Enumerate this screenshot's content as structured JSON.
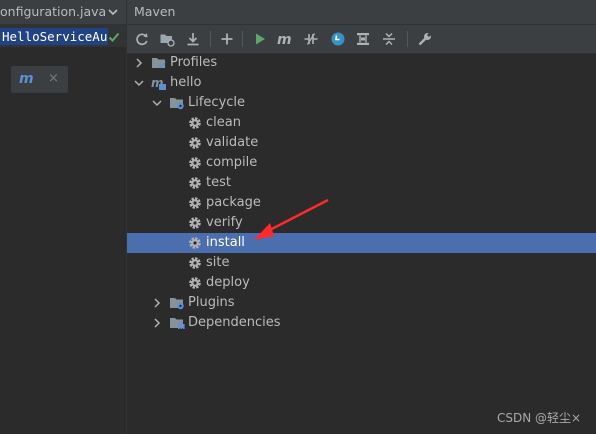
{
  "editor": {
    "tab_title": "onfiguration.java",
    "code_text": "HelloServiceAu"
  },
  "left_panel": {
    "file_close_glyph": "×"
  },
  "maven": {
    "title": "Maven",
    "toolbar": [
      {
        "name": "reload-icon"
      },
      {
        "name": "generate-sources-icon"
      },
      {
        "name": "download-icon"
      },
      {
        "name": "add-icon"
      },
      {
        "name": "run-icon"
      },
      {
        "name": "execute-goal-icon"
      },
      {
        "name": "toggle-offline-icon"
      },
      {
        "name": "skip-tests-icon"
      },
      {
        "name": "show-dependencies-icon"
      },
      {
        "name": "collapse-all-icon"
      },
      {
        "name": "settings-wrench-icon"
      }
    ],
    "tree": {
      "profiles": "Profiles",
      "project": "hello",
      "lifecycle": "Lifecycle",
      "goals": [
        "clean",
        "validate",
        "compile",
        "test",
        "package",
        "verify",
        "install",
        "site",
        "deploy"
      ],
      "selected_goal": "install",
      "plugins": "Plugins",
      "dependencies": "Dependencies"
    }
  },
  "colors": {
    "selection": "#4b6eaf",
    "annotation_arrow": "#ff2a2a",
    "run_green": "#59a869",
    "folder_blue": "#5c8fd6"
  },
  "watermark": "CSDN @轻尘×"
}
